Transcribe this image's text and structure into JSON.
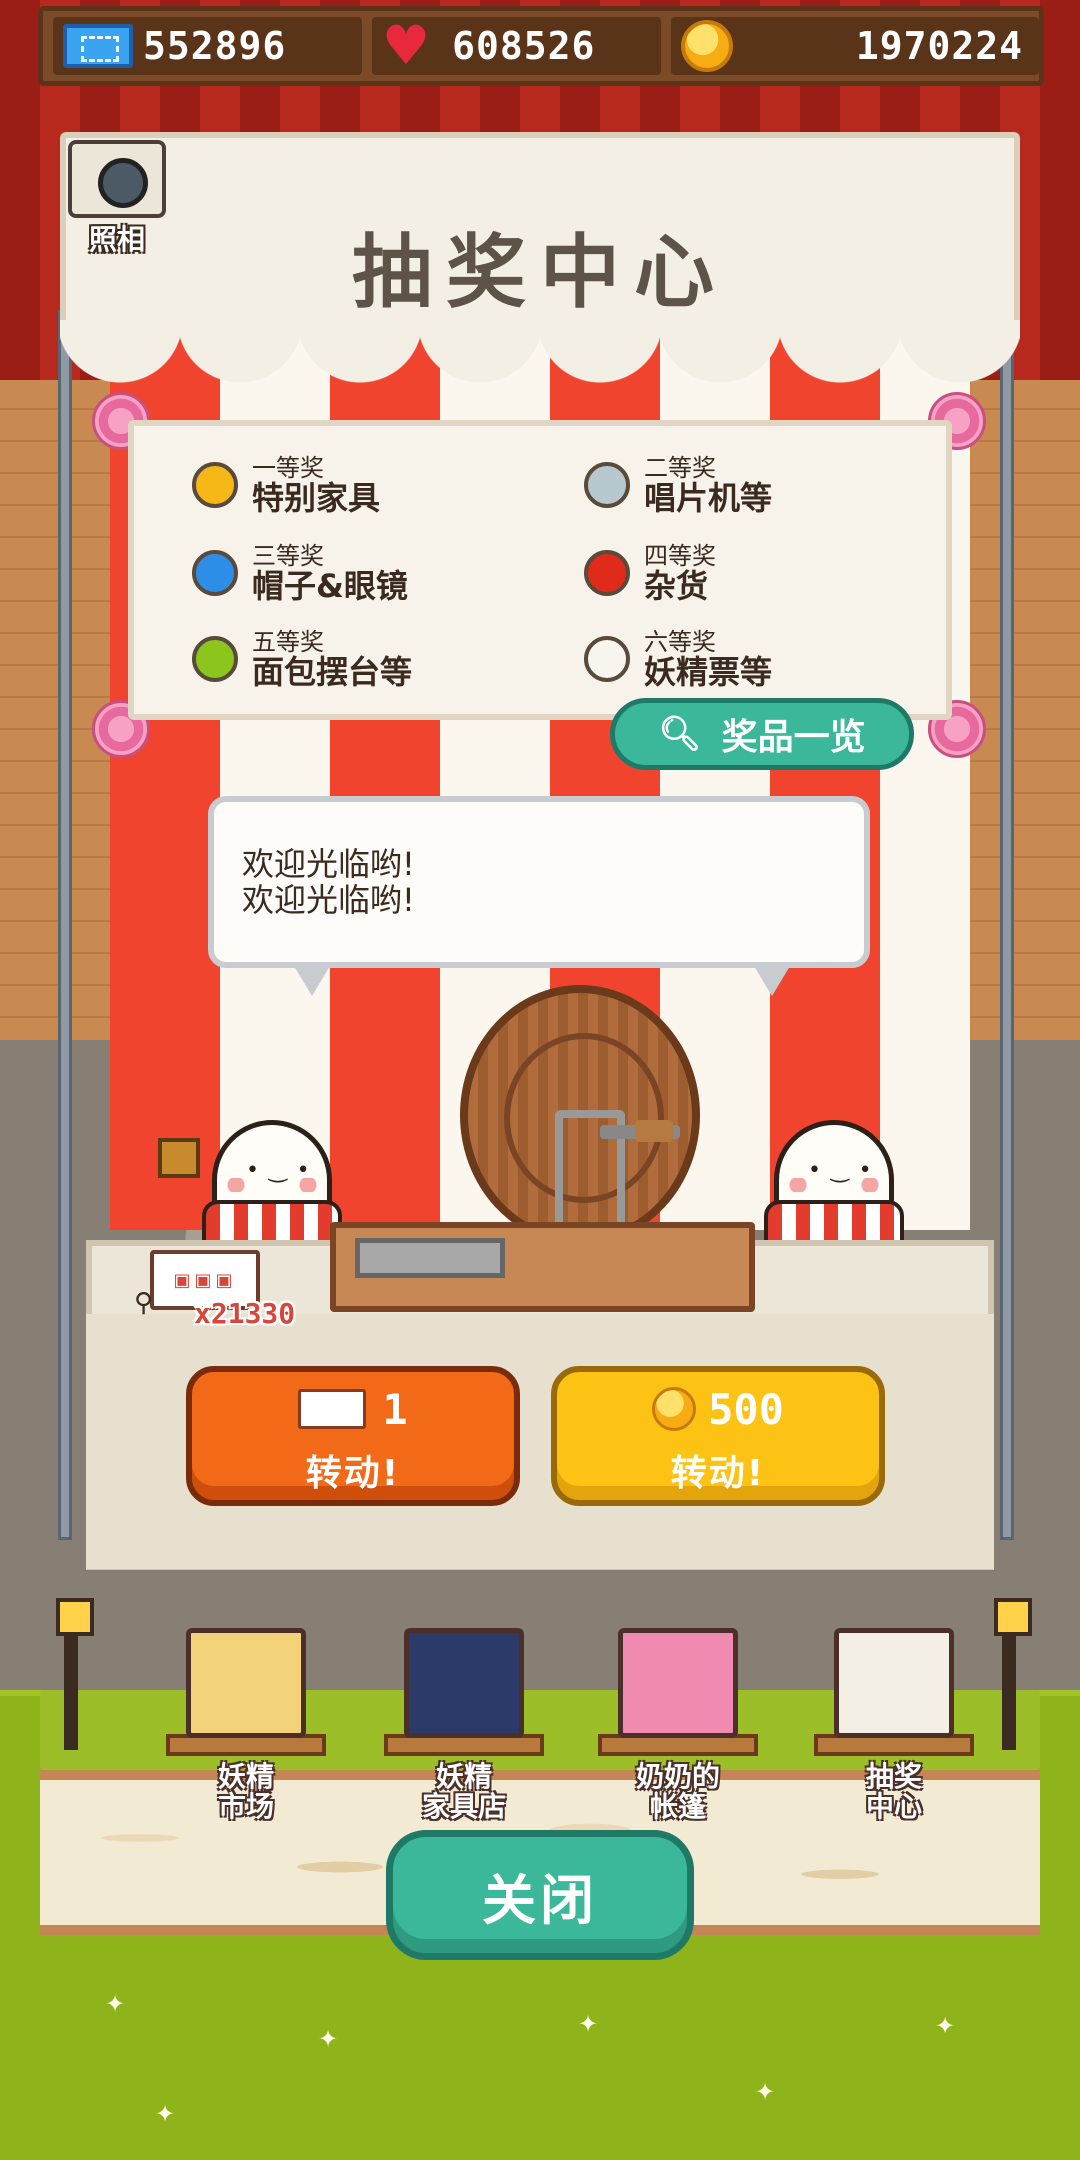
{
  "currency": {
    "tickets": "552896",
    "hearts": "608526",
    "coins": "1970224",
    "icons": [
      "ticket-icon",
      "heart-icon",
      "coin-icon"
    ]
  },
  "camera": {
    "label": "照相"
  },
  "booth": {
    "title": "抽奖中心"
  },
  "prizes": [
    {
      "rank": "一等奖",
      "item": "特别家具",
      "color": "#f5b816"
    },
    {
      "rank": "二等奖",
      "item": "唱片机等",
      "color": "#b7c9cf"
    },
    {
      "rank": "三等奖",
      "item": "帽子&眼镜",
      "color": "#2c8ee6"
    },
    {
      "rank": "四等奖",
      "item": "杂货",
      "color": "#e02a1a"
    },
    {
      "rank": "五等奖",
      "item": "面包摆台等",
      "color": "#8cc61c"
    },
    {
      "rank": "六等奖",
      "item": "妖精票等",
      "color": "#f7f5ee"
    }
  ],
  "prize_list_button": "奖品一览",
  "speech": {
    "line1": "欢迎光临哟!",
    "line2": "欢迎光临哟!"
  },
  "ticket_stack": {
    "count": "x21330"
  },
  "spin_ticket": {
    "cost": "1",
    "label": "转动!"
  },
  "spin_coin": {
    "cost": "500",
    "label": "转动!"
  },
  "buildings": [
    {
      "label_line1": "妖精",
      "label_line2": "市场",
      "color": "#f3d27a"
    },
    {
      "label_line1": "妖精",
      "label_line2": "家具店",
      "color": "#2c3a6a"
    },
    {
      "label_line1": "奶奶的",
      "label_line2": "帐篷",
      "color": "#f08ab0"
    },
    {
      "label_line1": "抽奖",
      "label_line2": "中心",
      "color": "#f4efe4"
    }
  ],
  "close_button": "关闭"
}
